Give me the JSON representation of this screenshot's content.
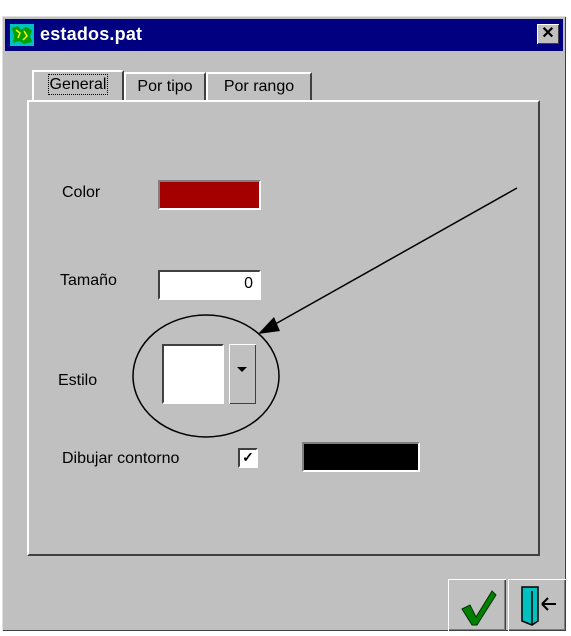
{
  "window": {
    "title": "estados.pat",
    "close_glyph": "✕"
  },
  "tabs": [
    {
      "label": "General",
      "active": true
    },
    {
      "label": "Por tipo",
      "active": false
    },
    {
      "label": "Por rango",
      "active": false
    }
  ],
  "form": {
    "color_label": "Color",
    "color_value": "#a40000",
    "size_label": "Tamaño",
    "size_value": "0",
    "style_label": "Estilo",
    "outline_label": "Dibujar contorno",
    "outline_checked": true,
    "outline_check_glyph": "✓",
    "outline_color": "#000000"
  },
  "buttons": {
    "ok_icon": "checkmark-icon",
    "exit_icon": "exit-door-icon"
  },
  "colors": {
    "titlebar": "#000080",
    "face": "#c0c0c0",
    "ok_check": "#008000"
  }
}
